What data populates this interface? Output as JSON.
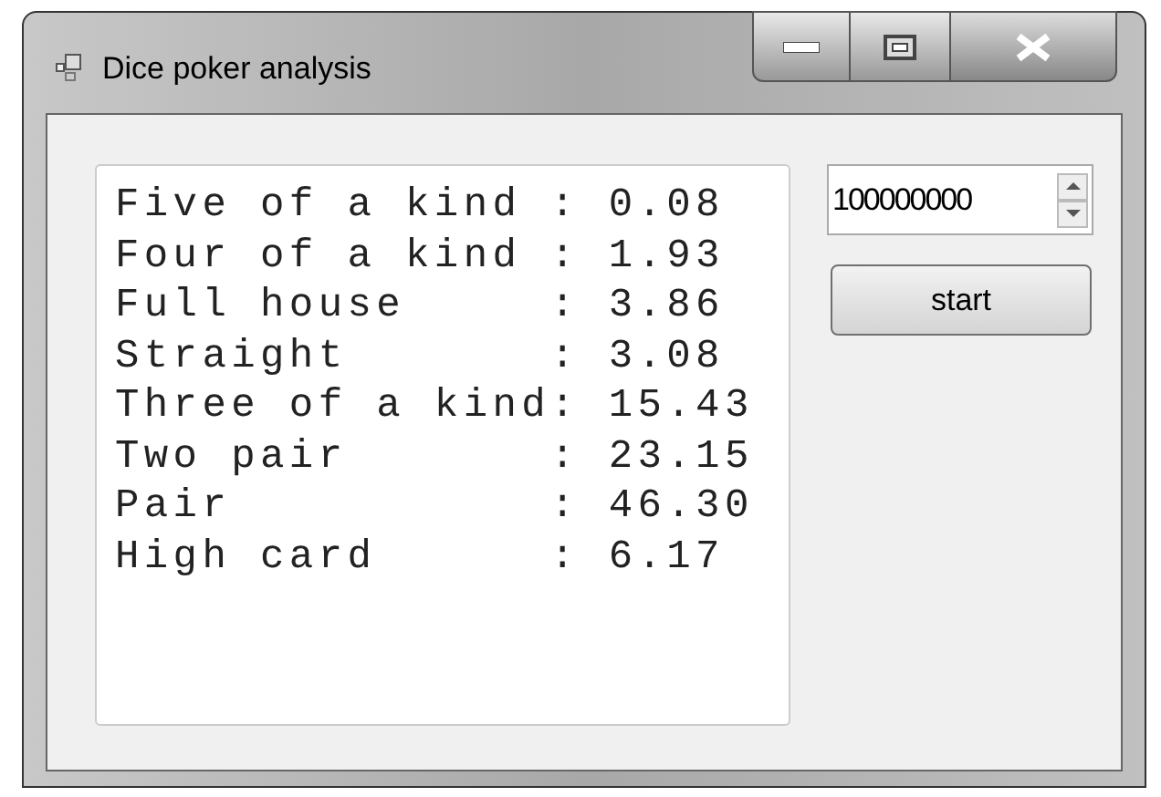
{
  "window": {
    "title": "Dice poker analysis"
  },
  "results": [
    "Five of a kind : 0.08",
    "Four of a kind : 1.93",
    "Full house     : 3.86",
    "Straight       : 3.08",
    "Three of a kind: 15.43",
    "Two pair       : 23.15",
    "Pair           : 46.30",
    "High card      : 6.17"
  ],
  "count_field": {
    "value": "100000000"
  },
  "start_button": {
    "label": "start"
  }
}
